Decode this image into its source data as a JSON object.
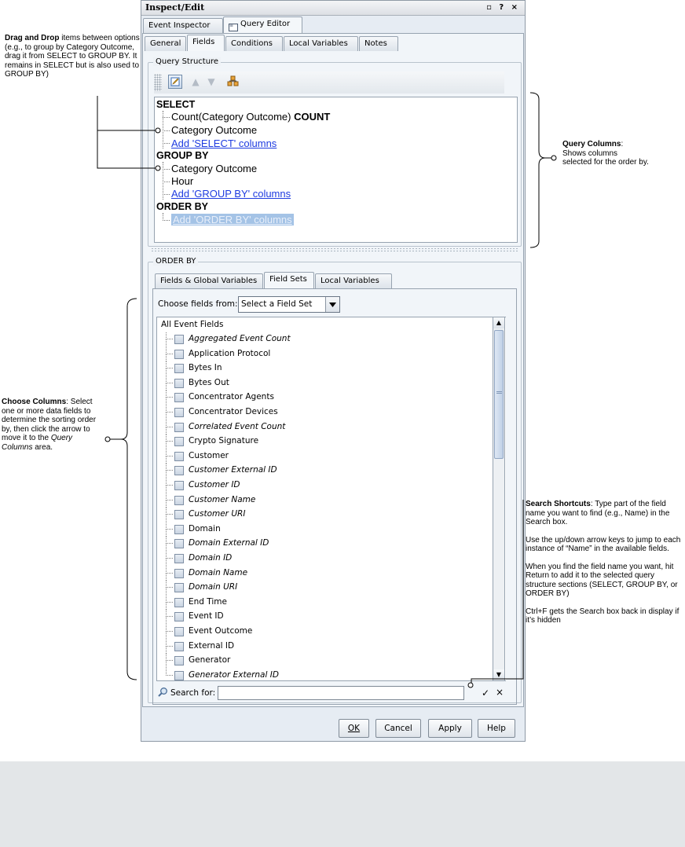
{
  "window": {
    "title": "Inspect/Edit",
    "title_controls": "▫ ? ×",
    "main_tabs": [
      {
        "label": "Event Inspector",
        "active": false
      },
      {
        "label": "Query Editor",
        "active": true
      }
    ],
    "sub_tabs": [
      {
        "label": "General"
      },
      {
        "label": "Fields",
        "active": true
      },
      {
        "label": "Conditions"
      },
      {
        "label": "Local Variables"
      },
      {
        "label": "Notes"
      }
    ]
  },
  "query_structure": {
    "group_label": "Query Structure",
    "sections": [
      {
        "header": "SELECT",
        "items": [
          {
            "text": "Count(Category Outcome) ",
            "bold_suffix": "COUNT"
          },
          {
            "text": "Category Outcome"
          }
        ],
        "add_link": "Add 'SELECT' columns"
      },
      {
        "header": "GROUP BY",
        "items": [
          {
            "text": "Category Outcome"
          },
          {
            "text": "Hour"
          }
        ],
        "add_link": "Add 'GROUP BY' columns"
      },
      {
        "header": "ORDER BY",
        "items": [],
        "add_link": "Add 'ORDER BY' columns"
      }
    ]
  },
  "order_by": {
    "group_label": "ORDER BY",
    "tabs": [
      {
        "label": "Fields & Global Variables"
      },
      {
        "label": "Field Sets",
        "active": true
      },
      {
        "label": "Local Variables"
      }
    ],
    "choose_label": "Choose fields from:",
    "choose_value": "Select a Field Set",
    "root_label": "All Event Fields",
    "fields": [
      {
        "label": "Aggregated Event Count",
        "italic": true
      },
      {
        "label": "Application Protocol",
        "italic": false
      },
      {
        "label": "Bytes In",
        "italic": false
      },
      {
        "label": "Bytes Out",
        "italic": false
      },
      {
        "label": "Concentrator Agents",
        "italic": false
      },
      {
        "label": "Concentrator Devices",
        "italic": false
      },
      {
        "label": "Correlated Event Count",
        "italic": true
      },
      {
        "label": "Crypto Signature",
        "italic": false
      },
      {
        "label": "Customer",
        "italic": false
      },
      {
        "label": "Customer External ID",
        "italic": true
      },
      {
        "label": "Customer ID",
        "italic": true
      },
      {
        "label": "Customer Name",
        "italic": true
      },
      {
        "label": "Customer URI",
        "italic": true
      },
      {
        "label": "Domain",
        "italic": false
      },
      {
        "label": "Domain External ID",
        "italic": true
      },
      {
        "label": "Domain ID",
        "italic": true
      },
      {
        "label": "Domain Name",
        "italic": true
      },
      {
        "label": "Domain URI",
        "italic": true
      },
      {
        "label": "End Time",
        "italic": false
      },
      {
        "label": "Event ID",
        "italic": false
      },
      {
        "label": "Event Outcome",
        "italic": false
      },
      {
        "label": "External ID",
        "italic": false
      },
      {
        "label": "Generator",
        "italic": false
      },
      {
        "label": "Generator External ID",
        "italic": true
      }
    ],
    "search_label": "Search for:",
    "search_value": ""
  },
  "buttons": {
    "ok": "OK",
    "cancel": "Cancel",
    "apply": "Apply",
    "help": "Help"
  },
  "annotations": {
    "drag_drop": {
      "title": "Drag and Drop",
      "text": " items between options (e.g., to group by Category Outcome, drag it from SELECT to GROUP BY. It remains in SELECT but is also used to GROUP BY)"
    },
    "query_columns": {
      "title": "Query Columns",
      "text": ": Shows columns selected for the order by."
    },
    "choose_columns": {
      "title": "Choose Columns",
      "text_a": ": Select one or more data fields to determine the sorting order by, then click the arrow to move it to the ",
      "text_em": "Query Columns",
      "text_b": " area."
    },
    "search_shortcuts": {
      "title": "Search Shortcuts",
      "p1": ": Type part of the field name you want to find (e.g., Name) in the Search box.",
      "p2": "Use the up/down arrow keys to jump to each instance of “Name” in the available fields.",
      "p3": "When you find the field name you want, hit Return to add it to the selected query structure sections (SELECT, GROUP BY, or ORDER BY)",
      "p4": "Ctrl+F gets the Search box back in display  if it’s hidden"
    }
  }
}
